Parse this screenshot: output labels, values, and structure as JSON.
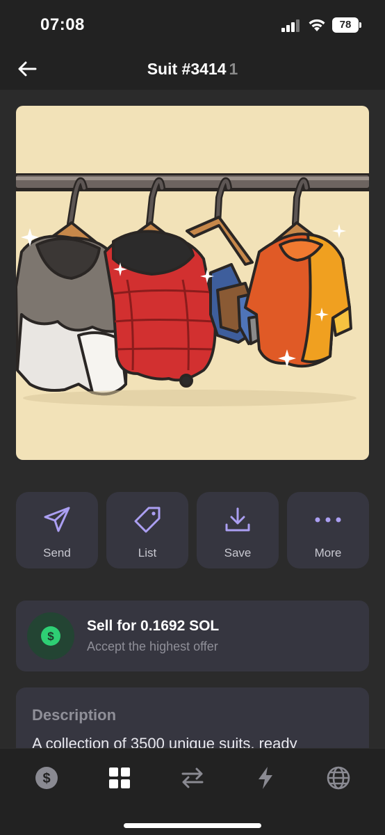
{
  "status_bar": {
    "time": "07:08",
    "battery": "78"
  },
  "header": {
    "title": "Suit #3414",
    "count": "1"
  },
  "nft": {
    "image_alt": "Suit #3414"
  },
  "actions": [
    {
      "label": "Send",
      "icon": "send-icon"
    },
    {
      "label": "List",
      "icon": "tag-icon"
    },
    {
      "label": "Save",
      "icon": "download-icon"
    },
    {
      "label": "More",
      "icon": "more-dots-icon"
    }
  ],
  "sell": {
    "title": "Sell for 0.1692 SOL",
    "subtitle": "Accept the highest offer",
    "icon": "dollar-icon"
  },
  "description": {
    "heading": "Description",
    "text": "A collection of 3500 unique suits, ready"
  },
  "bottom_nav": [
    {
      "name": "wallet",
      "icon": "dollar-circle-icon"
    },
    {
      "name": "collectibles",
      "icon": "grid-icon",
      "active": true
    },
    {
      "name": "swap",
      "icon": "swap-arrows-icon"
    },
    {
      "name": "activity",
      "icon": "lightning-icon"
    },
    {
      "name": "explore",
      "icon": "globe-icon"
    }
  ],
  "colors": {
    "background": "#222222",
    "card": "#363640",
    "accent": "#ab9ff2",
    "green": "#2ecf74"
  }
}
